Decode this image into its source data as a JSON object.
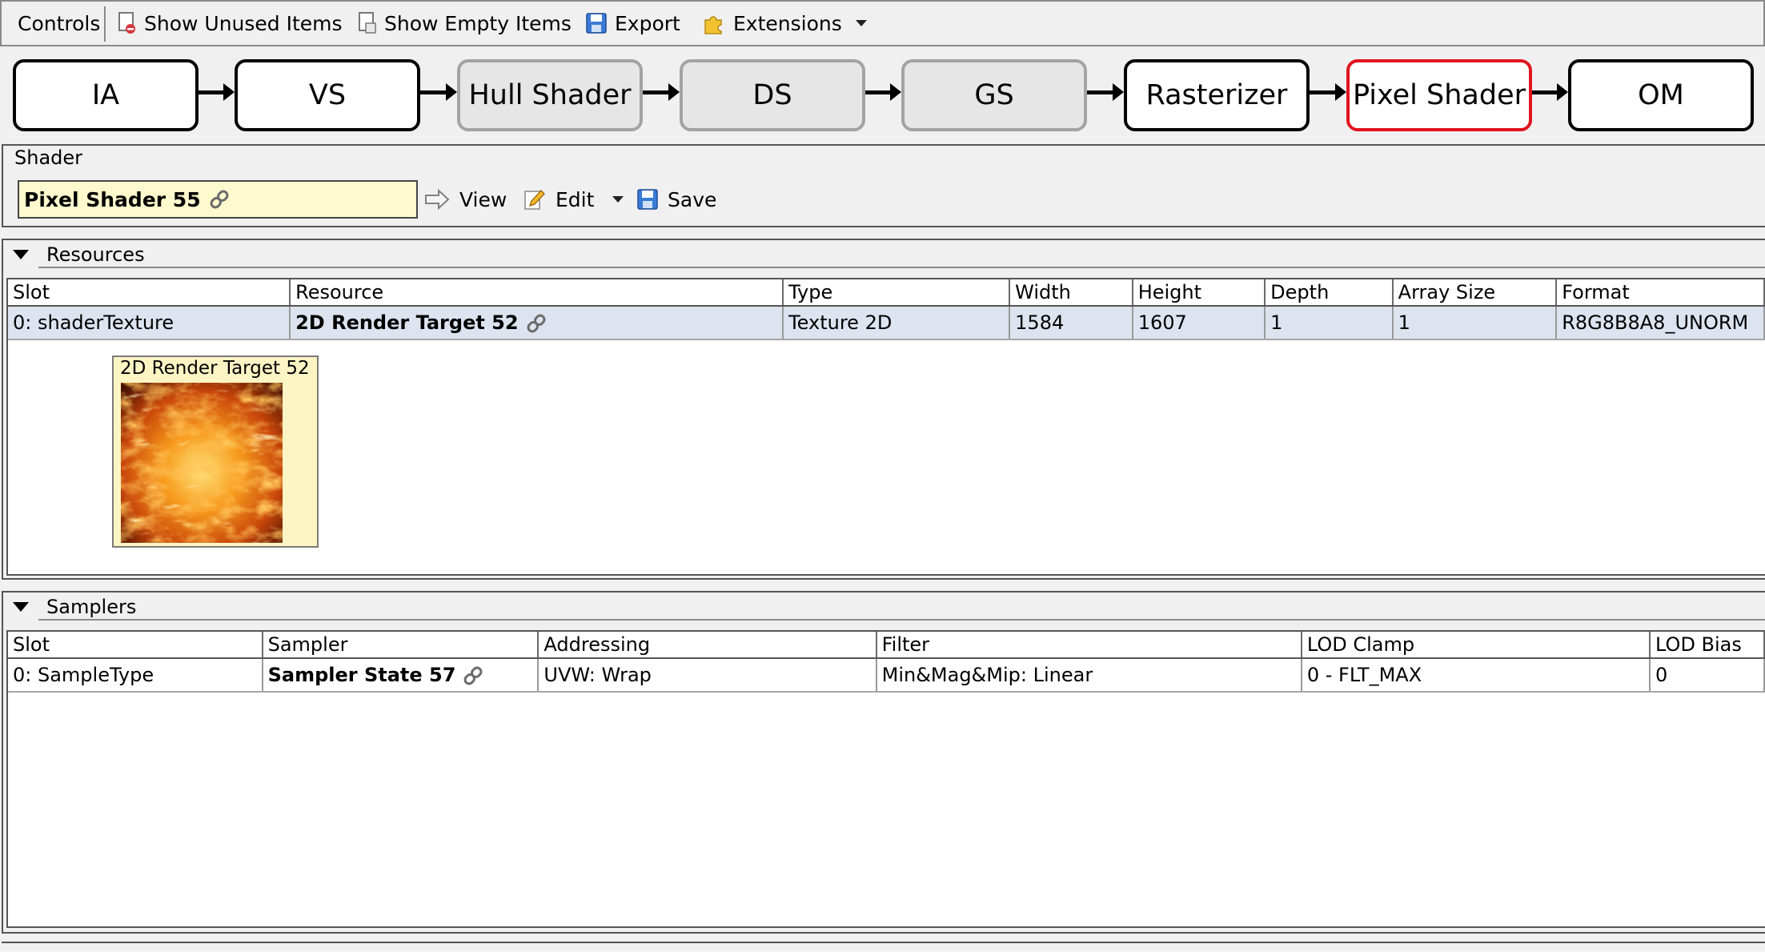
{
  "toolbar": {
    "controls": "Controls",
    "show_unused": "Show Unused Items",
    "show_empty": "Show Empty Items",
    "export": "Export",
    "extensions": "Extensions"
  },
  "pipeline": {
    "stages": [
      "IA",
      "VS",
      "Hull Shader",
      "DS",
      "GS",
      "Rasterizer",
      "Pixel Shader",
      "OM"
    ],
    "inactive": [
      "Hull Shader",
      "DS",
      "GS"
    ],
    "selected": "Pixel Shader"
  },
  "shader": {
    "label": "Shader",
    "name": "Pixel Shader 55",
    "view": "View",
    "edit": "Edit",
    "save": "Save"
  },
  "resources": {
    "title": "Resources",
    "columns": [
      "Slot",
      "Resource",
      "Type",
      "Width",
      "Height",
      "Depth",
      "Array Size",
      "Format"
    ],
    "rows": [
      [
        "0: shaderTexture",
        "2D Render Target 52",
        "Texture 2D",
        "1584",
        "1607",
        "1",
        "1",
        "R8G8B8A8_UNORM"
      ]
    ],
    "thumbnail_label": "2D Render Target 52"
  },
  "samplers": {
    "title": "Samplers",
    "columns": [
      "Slot",
      "Sampler",
      "Addressing",
      "Filter",
      "LOD Clamp",
      "LOD Bias"
    ],
    "rows": [
      [
        "0: SampleType",
        "Sampler State 57",
        "UVW: Wrap",
        "Min&Mag&Mip: Linear",
        "0 - FLT_MAX",
        "0"
      ]
    ]
  },
  "colors": {
    "selected_stage_border": "#e0141e",
    "shader_box_bg": "#fffacd",
    "selected_row_bg": "#dde3ef"
  }
}
